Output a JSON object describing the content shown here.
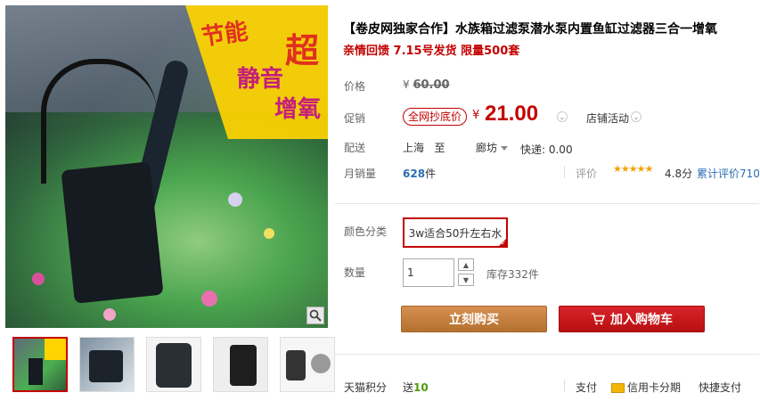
{
  "gallery": {
    "promo_words": [
      "节能",
      "超",
      "静音",
      "增氧"
    ],
    "thumbnail_count": 5,
    "active_thumbnail": 1
  },
  "product": {
    "title": "【卷皮网独家合作】水族箱过滤泵潜水泵内置鱼缸过滤器三合一增氧",
    "subtitle": "亲情回馈 7.15号发货 限量500套"
  },
  "price": {
    "label": "价格",
    "currency": "¥",
    "original": "60.00"
  },
  "promotion": {
    "label": "促销",
    "tag": "全网抄底价",
    "currency": "¥",
    "price": "21.00",
    "shop_activity": "店铺活动"
  },
  "shipping": {
    "label": "配送",
    "from": "上海",
    "to_word": "至",
    "to": "廊坊",
    "fee": "快递: 0.00"
  },
  "sales": {
    "label": "月销量",
    "count": "628",
    "unit": "件"
  },
  "rating": {
    "label": "评价",
    "stars": "★★★★★",
    "score": "4.8分",
    "reviews": "累计评价710"
  },
  "options": {
    "color_label": "颜色分类",
    "color_value": "3w适合50升左右水"
  },
  "quantity": {
    "label": "数量",
    "value": "1",
    "stock": "库存332件"
  },
  "buttons": {
    "buy": "立刻购买",
    "cart": "加入购物车"
  },
  "footer": {
    "points_label": "天猫积分",
    "points_prefix": "送",
    "points_value": "10",
    "pay_label": "支付",
    "credit": "信用卡分期",
    "quick": "快捷支付"
  },
  "colors": {
    "accent": "#c40000",
    "buy_button": "#c27c3d",
    "cart_button": "#c8161d",
    "link": "#2b6db5"
  }
}
